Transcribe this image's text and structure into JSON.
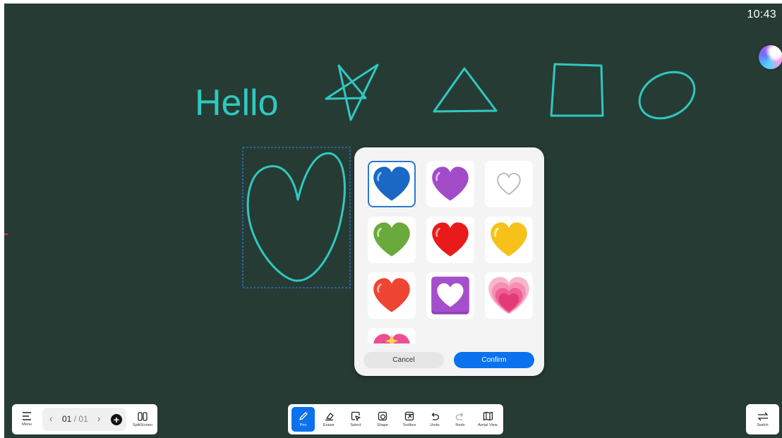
{
  "status": {
    "clock": "10:43"
  },
  "canvas": {
    "handwritten_text": "Hello",
    "stroke_color": "#2ec9bf",
    "background": "#273b35"
  },
  "emoji_picker": {
    "items": [
      {
        "name": "blue-heart-icon",
        "selected": true
      },
      {
        "name": "purple-heart-icon"
      },
      {
        "name": "white-heart-icon"
      },
      {
        "name": "green-heart-icon"
      },
      {
        "name": "red-heart-icon"
      },
      {
        "name": "yellow-heart-icon"
      },
      {
        "name": "orange-red-heart-icon"
      },
      {
        "name": "heart-decoration-icon"
      },
      {
        "name": "revolving-hearts-icon"
      },
      {
        "name": "sparkling-heart-icon"
      }
    ],
    "cancel_label": "Cancel",
    "confirm_label": "Confirm"
  },
  "left_toolbar": {
    "menu_label": "Menu",
    "page_current": "01",
    "page_separator": "/",
    "page_total": "01",
    "split_label": "SplitScreen"
  },
  "main_toolbar": {
    "tools": [
      {
        "label": "Pen",
        "active": true
      },
      {
        "label": "Eraser"
      },
      {
        "label": "Select"
      },
      {
        "label": "Shape"
      },
      {
        "label": "Toolbox"
      },
      {
        "label": "Undo"
      },
      {
        "label": "Redo"
      },
      {
        "label": "Aerial View"
      }
    ]
  },
  "right_toolbar": {
    "switch_label": "Switch"
  },
  "colors": {
    "accent": "#0a72ee",
    "selection": "#2a78d1"
  }
}
